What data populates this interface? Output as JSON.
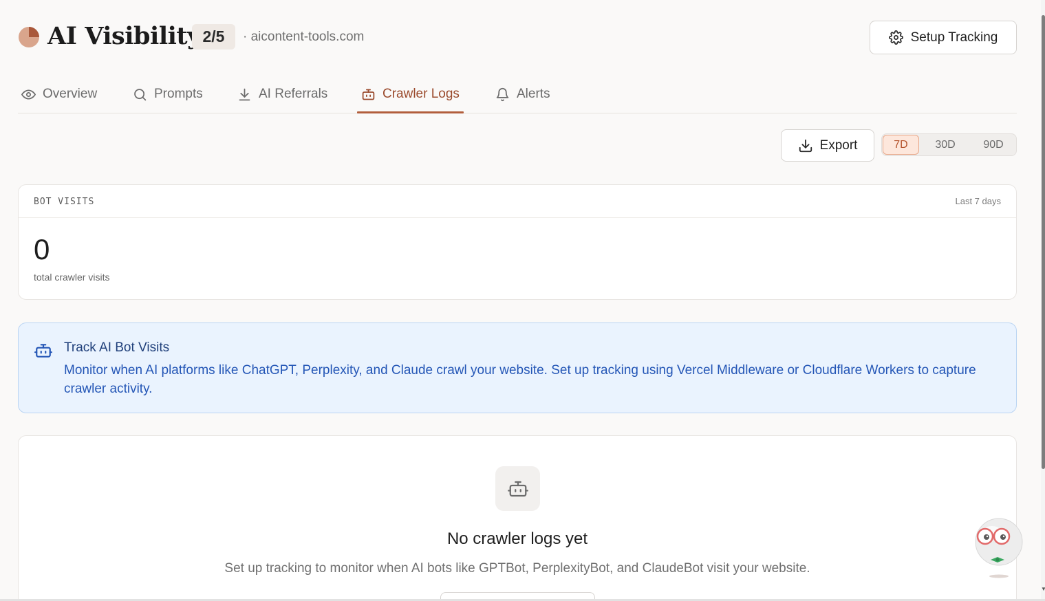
{
  "header": {
    "title": "AI Visibility",
    "step_badge": "2/5",
    "domain": "· aicontent-tools.com",
    "setup_button": "Setup Tracking",
    "logo_icon": "pie-chart-icon"
  },
  "tabs": [
    {
      "label": "Overview",
      "icon": "eye-icon",
      "active": false
    },
    {
      "label": "Prompts",
      "icon": "search-icon",
      "active": false
    },
    {
      "label": "AI Referrals",
      "icon": "download-arrow-icon",
      "active": false
    },
    {
      "label": "Crawler Logs",
      "icon": "bot-icon",
      "active": true
    },
    {
      "label": "Alerts",
      "icon": "bell-icon",
      "active": false
    }
  ],
  "toolbar": {
    "export_label": "Export",
    "ranges": [
      "7D",
      "30D",
      "90D"
    ],
    "selected_range": "7D"
  },
  "stat_card": {
    "label": "BOT VISITS",
    "range": "Last 7 days",
    "value": "0",
    "sublabel": "total crawler visits"
  },
  "banner": {
    "title": "Track AI Bot Visits",
    "text": "Monitor when AI platforms like ChatGPT, Perplexity, and Claude crawl your website. Set up tracking using Vercel Middleware or Cloudflare Workers to capture crawler activity."
  },
  "empty_state": {
    "title": "No crawler logs yet",
    "text": "Set up tracking to monitor when AI bots like GPTBot, PerplexityBot, and ClaudeBot visit your website."
  },
  "colors": {
    "accent": "#b25e3c",
    "active_tab_text": "#9a4a2c",
    "banner_bg": "#eaf3fe",
    "banner_text": "#2456b6",
    "page_bg": "#faf9f8"
  }
}
